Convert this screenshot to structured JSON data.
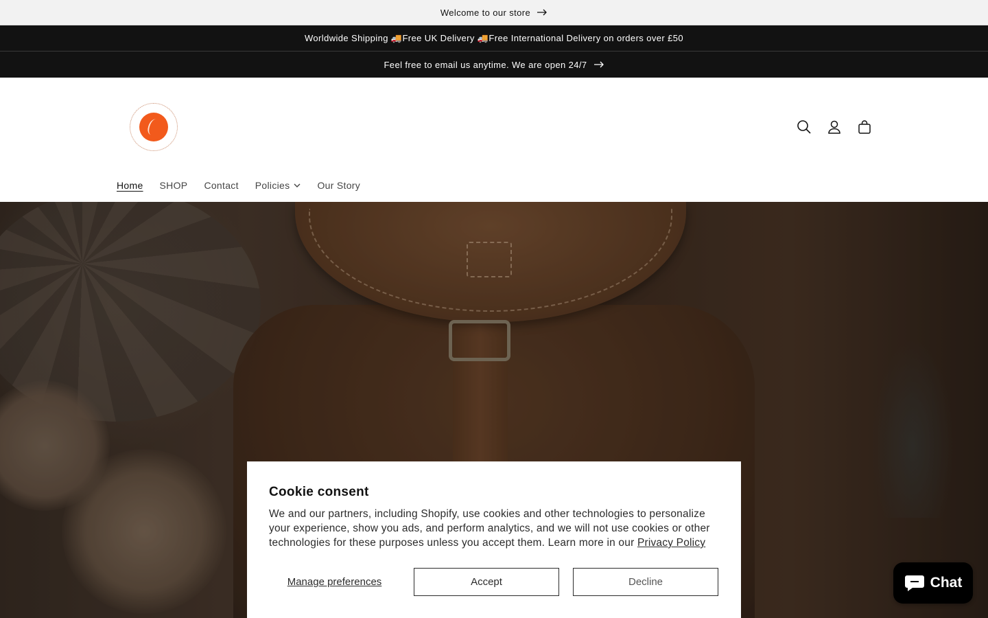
{
  "announcements": {
    "welcome": "Welcome to our store",
    "shipping": "Worldwide Shipping 🚚Free UK Delivery 🚚Free International Delivery on orders over £50",
    "email": "Feel free to email us anytime. We are open 24/7"
  },
  "header": {
    "icons": [
      "search-icon",
      "account-icon",
      "cart-icon"
    ]
  },
  "nav": {
    "home": "Home",
    "shop": "SHOP",
    "contact": "Contact",
    "policies": "Policies",
    "our_story": "Our Story"
  },
  "cookie": {
    "title": "Cookie consent",
    "body": "We and our partners, including Shopify, use cookies and other technologies to personalize your experience, show you ads, and perform analytics, and we will not use cookies or other technologies for these purposes unless you accept them. Learn more in our ",
    "link": "Privacy Policy",
    "manage": "Manage preferences",
    "accept": "Accept",
    "decline": "Decline"
  },
  "chat": {
    "label": "Chat"
  },
  "colors": {
    "announcement_dark": "#121212",
    "announcement_light": "#f2f2f2",
    "logo_orange": "#f25a1c",
    "chat_bg": "#000000"
  }
}
